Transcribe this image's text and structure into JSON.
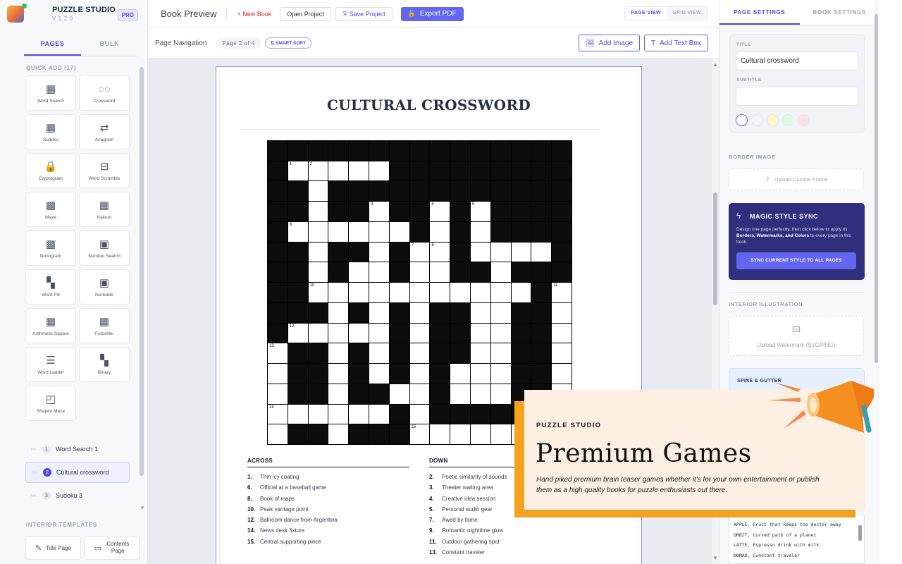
{
  "app": {
    "name": "PUZZLE STUDIO",
    "version": "V 1.2.0",
    "badge": "PRO"
  },
  "left": {
    "tabs": [
      "PAGES",
      "BULK"
    ],
    "quick_add_label": "QUICK ADD (17)",
    "quick_add": [
      {
        "label": "Word Search",
        "icon": "word-search-icon"
      },
      {
        "label": "Crossword",
        "icon": "crossword-icon"
      },
      {
        "label": "Sudoku",
        "icon": "sudoku-icon"
      },
      {
        "label": "Anagram",
        "icon": "anagram-icon"
      },
      {
        "label": "Cryptogram",
        "icon": "lock-icon"
      },
      {
        "label": "Word Scramble",
        "icon": "scramble-icon"
      },
      {
        "label": "Maze",
        "icon": "maze-icon"
      },
      {
        "label": "Kakuro",
        "icon": "kakuro-icon"
      },
      {
        "label": "Nonogram",
        "icon": "nonogram-icon"
      },
      {
        "label": "Number Search",
        "icon": "number-search-icon"
      },
      {
        "label": "Word Fill",
        "icon": "word-fill-icon"
      },
      {
        "label": "Nurikabe",
        "icon": "nurikabe-icon"
      },
      {
        "label": "Arithmetic Square",
        "icon": "arithmetic-square-icon"
      },
      {
        "label": "Futoshiki",
        "icon": "futoshiki-icon"
      },
      {
        "label": "Word Ladder",
        "icon": "word-ladder-icon"
      },
      {
        "label": "Binary",
        "icon": "binary-icon"
      },
      {
        "label": "Shaped Maze",
        "icon": "shaped-maze-icon"
      }
    ],
    "pages": [
      {
        "num": "1",
        "label": "Word Search 1",
        "active": false
      },
      {
        "num": "2",
        "label": "Cultural crossword",
        "active": true
      },
      {
        "num": "3",
        "label": "Sudoku 3",
        "active": false
      }
    ],
    "templates_label": "INTERIOR TEMPLATES",
    "templates": [
      {
        "label": "Title Page",
        "icon": "title-page-icon"
      },
      {
        "label": "Contents Page",
        "icon": "contents-page-icon"
      }
    ]
  },
  "topbar": {
    "title": "Book Preview",
    "new_book": "+ New Book",
    "open_project": "Open Project",
    "save_project": "Save Project",
    "export_pdf": "Export PDF",
    "views": [
      "PAGE VIEW",
      "GRID VIEW"
    ],
    "active_view": "PAGE VIEW"
  },
  "subbar": {
    "nav_label": "Page Navigation",
    "page_indicator": "Page 2 of 4",
    "smart_sort": "SMART SORT",
    "add_image": "Add Image",
    "add_text_box": "Add Text Box"
  },
  "page": {
    "title": "CULTURAL CROSSWORD",
    "across_label": "ACROSS",
    "down_label": "DOWN",
    "across": [
      {
        "n": "1.",
        "t": "Thin icy coating"
      },
      {
        "n": "6.",
        "t": "Official at a baseball game"
      },
      {
        "n": "8.",
        "t": "Book of maps"
      },
      {
        "n": "10.",
        "t": "Peak vantage point"
      },
      {
        "n": "12.",
        "t": "Ballroom dance from Argentina"
      },
      {
        "n": "14.",
        "t": "News desk fixture"
      },
      {
        "n": "15.",
        "t": "Central supporting piece"
      }
    ],
    "down": [
      {
        "n": "2.",
        "t": "Poetic similarity of sounds"
      },
      {
        "n": "3.",
        "t": "Theater waiting area"
      },
      {
        "n": "4.",
        "t": "Creative idea session"
      },
      {
        "n": "5.",
        "t": "Personal audio gear"
      },
      {
        "n": "7.",
        "t": "Awed by fame"
      },
      {
        "n": "9.",
        "t": "Romantic nighttime glow"
      },
      {
        "n": "11.",
        "t": "Outdoor gathering spot"
      },
      {
        "n": "13.",
        "t": "Constant traveler"
      }
    ],
    "grid_rows": [
      "...............",
      ".wwwww.........",
      "..w............",
      "..w..w..w.w....",
      ".wwwwww.w.w....",
      "..w..w.ww.wwww.",
      "..w.ww.ww..w...",
      "..wwwwwwwwwww.w",
      "...w.w.w..ww..w",
      ".wwwww.w..ww..w",
      "w..w.w.w..ww..w",
      "w..w.w.w.www..w",
      "w..w..ww.www..w",
      "wwwwww.w.....ww",
      "w..w...wwwwwwww"
    ],
    "grid_numbers": [
      {
        "r": 1,
        "c": 1,
        "n": "1"
      },
      {
        "r": 1,
        "c": 2,
        "n": "2"
      },
      {
        "r": 3,
        "c": 5,
        "n": "3"
      },
      {
        "r": 3,
        "c": 8,
        "n": "4"
      },
      {
        "r": 3,
        "c": 10,
        "n": "5"
      },
      {
        "r": 4,
        "c": 1,
        "n": "6"
      },
      {
        "r": 5,
        "c": 7,
        "n": "7"
      },
      {
        "r": 5,
        "c": 8,
        "n": "8"
      },
      {
        "r": 6,
        "c": 3,
        "n": "9"
      },
      {
        "r": 7,
        "c": 2,
        "n": "10"
      },
      {
        "r": 7,
        "c": 14,
        "n": "11"
      },
      {
        "r": 9,
        "c": 1,
        "n": "12"
      },
      {
        "r": 10,
        "c": 0,
        "n": "13"
      },
      {
        "r": 13,
        "c": 0,
        "n": "14"
      },
      {
        "r": 14,
        "c": 7,
        "n": "15"
      }
    ]
  },
  "right": {
    "tabs": [
      "PAGE SETTINGS",
      "BOOK SETTINGS"
    ],
    "title_label": "TITLE",
    "title_value": "Cultural crossword",
    "subtitle_label": "SUBTITLE",
    "subtitle_value": "",
    "swatches": [
      "#ffffff",
      "#f3f4f6",
      "#fef9c3",
      "#dcfce7",
      "#fee2e2"
    ],
    "border_label": "BORDER IMAGE",
    "upload_frame": "Upload Custom Frame",
    "magic_title": "MAGIC STYLE SYNC",
    "magic_desc_1": "Design one page perfectly, then click below to apply its ",
    "magic_desc_bold": "Borders, Watermarks, and Colors",
    "magic_desc_2": " to every page in this book.",
    "magic_button": "SYNC CURRENT STYLE TO ALL PAGES",
    "illustration_label": "INTERIOR ILLUSTRATION",
    "upload_watermark": "Upload Watermark (SVG/PNG)",
    "spine_label": "SPINE & GUTTER",
    "word_list": [
      "APPLE, Fruit that keeps the doctor away",
      "ORBIT, Curved path of a planet",
      "LATTE, Espresso drink with milk",
      "NOMAD, Constant traveler"
    ]
  },
  "promo": {
    "brand": "PUZZLE STUDIO",
    "title": "Premium Games",
    "description": "Hand piked premium brain teaser games whether it's for your own entertainment or publish them as a high quality books for puzzle enthusiasts out there.",
    "accent": "#f5a21f"
  }
}
